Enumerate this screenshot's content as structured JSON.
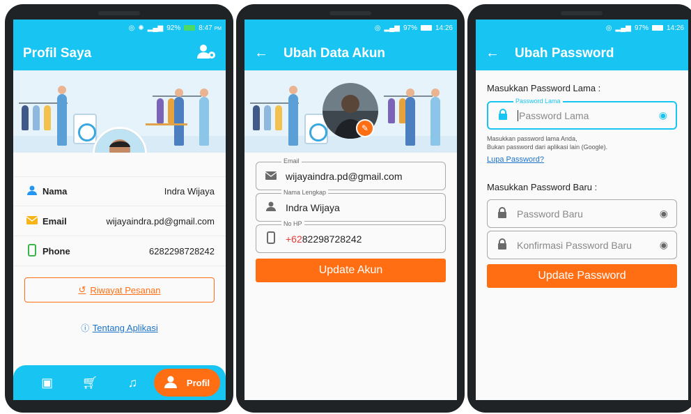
{
  "colors": {
    "primary": "#18c4f2",
    "accent": "#ff6e13",
    "link": "#1a73c9",
    "online": "#34c759"
  },
  "screen1": {
    "status": {
      "battery": "92%",
      "time": "8:47",
      "ampm": "PM"
    },
    "title": "Profil Saya",
    "rows": [
      {
        "label": "Nama",
        "value": "Indra Wijaya",
        "icon": "person-icon"
      },
      {
        "label": "Email",
        "value": "wijayaindra.pd@gmail.com",
        "icon": "mail-icon"
      },
      {
        "label": "Phone",
        "value": "6282298728242",
        "icon": "phone-icon"
      }
    ],
    "history_button": "Riwayat Pesanan",
    "about_link": "Tentang Aplikasi",
    "nav": {
      "active_label": "Profil",
      "items": [
        "laundry-icon",
        "cart-icon",
        "bell-icon",
        "profile-icon"
      ]
    }
  },
  "screen2": {
    "status": {
      "battery": "97%",
      "time": "14:26"
    },
    "title": "Ubah Data Akun",
    "email": {
      "label": "Email",
      "value": "wijayaindra.pd@gmail.com"
    },
    "name": {
      "label": "Nama Lengkap",
      "value": "Indra Wijaya"
    },
    "phone": {
      "label": "No HP",
      "prefix": "+62",
      "value": "82298728242"
    },
    "button": "Update Akun"
  },
  "screen3": {
    "status": {
      "battery": "97%",
      "time": "14:26"
    },
    "title": "Ubah Password",
    "old_section": "Masukkan Password Lama :",
    "old_field": {
      "label": "Password Lama",
      "placeholder": "Password Lama"
    },
    "help_line1": "Masukkan password lama Anda,",
    "help_line2": "Bukan password dari aplikasi lain (Google).",
    "forgot_link": "Lupa Password?",
    "new_section": "Masukkan Password Baru :",
    "new_field": {
      "placeholder": "Password Baru"
    },
    "confirm_field": {
      "placeholder": "Konfirmasi Password Baru"
    },
    "button": "Update Password"
  }
}
